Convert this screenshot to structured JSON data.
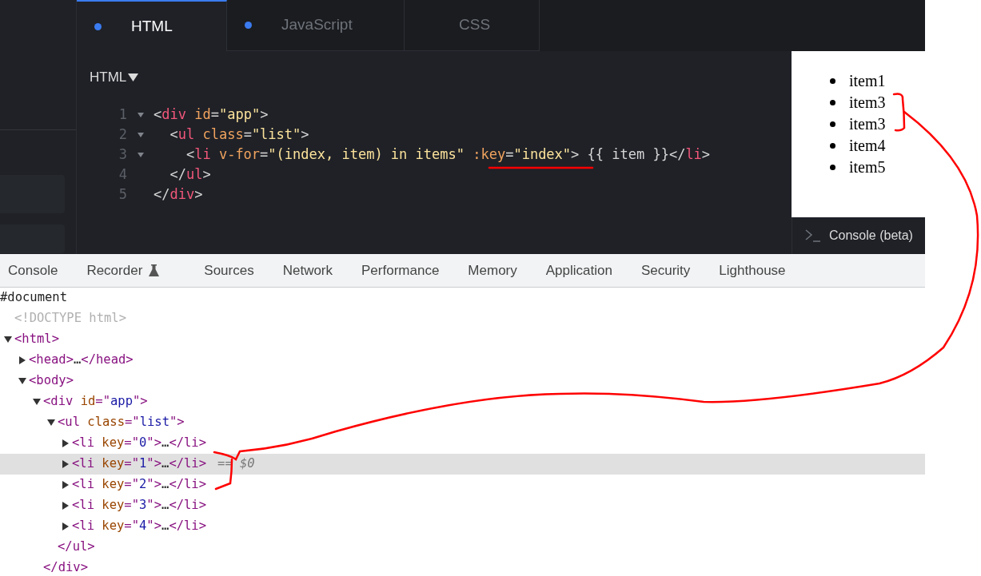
{
  "editor_tabs": [
    {
      "label": "HTML",
      "selected": true,
      "dot": true
    },
    {
      "label": "JavaScript",
      "selected": false,
      "dot": true
    },
    {
      "label": "CSS",
      "selected": false,
      "dot": false
    }
  ],
  "editor": {
    "language": "HTML",
    "lines": [
      {
        "number": "1",
        "foldable": true,
        "tokens": [
          {
            "kind": "punct",
            "text": "<"
          },
          {
            "kind": "tag",
            "text": "div"
          },
          {
            "kind": "attr",
            "text": " id"
          },
          {
            "kind": "punct",
            "text": "="
          },
          {
            "kind": "string",
            "text": "\"app\""
          },
          {
            "kind": "punct",
            "text": ">"
          }
        ]
      },
      {
        "number": "2",
        "foldable": true,
        "tokens": [
          {
            "kind": "punct",
            "text": "  <"
          },
          {
            "kind": "tag",
            "text": "ul"
          },
          {
            "kind": "attr",
            "text": " class"
          },
          {
            "kind": "punct",
            "text": "="
          },
          {
            "kind": "string",
            "text": "\"list\""
          },
          {
            "kind": "punct",
            "text": ">"
          }
        ]
      },
      {
        "number": "3",
        "foldable": true,
        "tokens": [
          {
            "kind": "punct",
            "text": "    <"
          },
          {
            "kind": "tag",
            "text": "li"
          },
          {
            "kind": "attr",
            "text": " v-for"
          },
          {
            "kind": "punct",
            "text": "="
          },
          {
            "kind": "string",
            "text": "\"(index, item) in items\""
          },
          {
            "kind": "attr",
            "text": " :key"
          },
          {
            "kind": "punct",
            "text": "="
          },
          {
            "kind": "string",
            "text": "\"index\""
          },
          {
            "kind": "punct",
            "text": "> {{ item }}</"
          },
          {
            "kind": "tag",
            "text": "li"
          },
          {
            "kind": "punct",
            "text": ">"
          }
        ]
      },
      {
        "number": "4",
        "foldable": false,
        "tokens": [
          {
            "kind": "punct",
            "text": "  </"
          },
          {
            "kind": "tag",
            "text": "ul"
          },
          {
            "kind": "punct",
            "text": ">"
          }
        ]
      },
      {
        "number": "5",
        "foldable": false,
        "tokens": [
          {
            "kind": "punct",
            "text": "</"
          },
          {
            "kind": "tag",
            "text": "div"
          },
          {
            "kind": "punct",
            "text": ">"
          }
        ]
      }
    ]
  },
  "preview": {
    "items": [
      "item1",
      "item3",
      "item3",
      "item4",
      "item5"
    ]
  },
  "console_button": {
    "label": "Console (beta)"
  },
  "devtools_tabs": [
    {
      "label": "Console",
      "kind": "plain"
    },
    {
      "label": "Recorder",
      "kind": "flask"
    },
    {
      "label": "Sources",
      "kind": "plain"
    },
    {
      "label": "Network",
      "kind": "plain"
    },
    {
      "label": "Performance",
      "kind": "plain"
    },
    {
      "label": "Memory",
      "kind": "plain"
    },
    {
      "label": "Application",
      "kind": "plain"
    },
    {
      "label": "Security",
      "kind": "plain"
    },
    {
      "label": "Lighthouse",
      "kind": "plain"
    }
  ],
  "dom_tree": {
    "root": "#document",
    "nodes": [
      {
        "tokens": [
          {
            "kind": "doctype",
            "text": "<!DOCTYPE html>"
          }
        ],
        "selected": false
      },
      {
        "tokens": [
          {
            "kind": "punct",
            "text": "<"
          },
          {
            "kind": "tag",
            "text": "html"
          },
          {
            "kind": "punct",
            "text": ">"
          }
        ],
        "expanded": true,
        "selected": false,
        "children": [
          {
            "tokens": [
              {
                "kind": "punct",
                "text": "<"
              },
              {
                "kind": "tag",
                "text": "head"
              },
              {
                "kind": "punct",
                "text": ">"
              },
              {
                "kind": "text",
                "text": "…"
              },
              {
                "kind": "punct",
                "text": "</"
              },
              {
                "kind": "tag",
                "text": "head"
              },
              {
                "kind": "punct",
                "text": ">"
              }
            ],
            "expanded": false,
            "selected": false
          },
          {
            "tokens": [
              {
                "kind": "punct",
                "text": "<"
              },
              {
                "kind": "tag",
                "text": "body"
              },
              {
                "kind": "punct",
                "text": ">"
              }
            ],
            "expanded": true,
            "selected": false,
            "children": [
              {
                "tokens": [
                  {
                    "kind": "punct",
                    "text": "<"
                  },
                  {
                    "kind": "tag",
                    "text": "div"
                  },
                  {
                    "kind": "attr",
                    "text": " id"
                  },
                  {
                    "kind": "punct",
                    "text": "=\""
                  },
                  {
                    "kind": "value",
                    "text": "app"
                  },
                  {
                    "kind": "punct",
                    "text": "\">"
                  }
                ],
                "expanded": true,
                "selected": false,
                "close": "</div>",
                "children": [
                  {
                    "tokens": [
                      {
                        "kind": "punct",
                        "text": "<"
                      },
                      {
                        "kind": "tag",
                        "text": "ul"
                      },
                      {
                        "kind": "attr",
                        "text": " class"
                      },
                      {
                        "kind": "punct",
                        "text": "=\""
                      },
                      {
                        "kind": "value",
                        "text": "list"
                      },
                      {
                        "kind": "punct",
                        "text": "\">"
                      }
                    ],
                    "expanded": true,
                    "selected": false,
                    "close": "</ul>",
                    "children": [
                      {
                        "tokens": [
                          {
                            "kind": "punct",
                            "text": "<"
                          },
                          {
                            "kind": "tag",
                            "text": "li"
                          },
                          {
                            "kind": "attr",
                            "text": " key"
                          },
                          {
                            "kind": "punct",
                            "text": "=\""
                          },
                          {
                            "kind": "value",
                            "text": "0"
                          },
                          {
                            "kind": "punct",
                            "text": "\">"
                          },
                          {
                            "kind": "text",
                            "text": "…"
                          },
                          {
                            "kind": "punct",
                            "text": "</li>"
                          }
                        ],
                        "expanded": false,
                        "selected": false
                      },
                      {
                        "tokens": [
                          {
                            "kind": "punct",
                            "text": "<"
                          },
                          {
                            "kind": "tag",
                            "text": "li"
                          },
                          {
                            "kind": "attr",
                            "text": " key"
                          },
                          {
                            "kind": "punct",
                            "text": "=\""
                          },
                          {
                            "kind": "value",
                            "text": "1"
                          },
                          {
                            "kind": "punct",
                            "text": "\">"
                          },
                          {
                            "kind": "text",
                            "text": "…"
                          },
                          {
                            "kind": "punct",
                            "text": "</li>"
                          }
                        ],
                        "expanded": false,
                        "selected": true,
                        "suffix": "== $0"
                      },
                      {
                        "tokens": [
                          {
                            "kind": "punct",
                            "text": "<"
                          },
                          {
                            "kind": "tag",
                            "text": "li"
                          },
                          {
                            "kind": "attr",
                            "text": " key"
                          },
                          {
                            "kind": "punct",
                            "text": "=\""
                          },
                          {
                            "kind": "value",
                            "text": "2"
                          },
                          {
                            "kind": "punct",
                            "text": "\">"
                          },
                          {
                            "kind": "text",
                            "text": "…"
                          },
                          {
                            "kind": "punct",
                            "text": "</li>"
                          }
                        ],
                        "expanded": false,
                        "selected": false
                      },
                      {
                        "tokens": [
                          {
                            "kind": "punct",
                            "text": "<"
                          },
                          {
                            "kind": "tag",
                            "text": "li"
                          },
                          {
                            "kind": "attr",
                            "text": " key"
                          },
                          {
                            "kind": "punct",
                            "text": "=\""
                          },
                          {
                            "kind": "value",
                            "text": "3"
                          },
                          {
                            "kind": "punct",
                            "text": "\">"
                          },
                          {
                            "kind": "text",
                            "text": "…"
                          },
                          {
                            "kind": "punct",
                            "text": "</li>"
                          }
                        ],
                        "expanded": false,
                        "selected": false
                      },
                      {
                        "tokens": [
                          {
                            "kind": "punct",
                            "text": "<"
                          },
                          {
                            "kind": "tag",
                            "text": "li"
                          },
                          {
                            "kind": "attr",
                            "text": " key"
                          },
                          {
                            "kind": "punct",
                            "text": "=\""
                          },
                          {
                            "kind": "value",
                            "text": "4"
                          },
                          {
                            "kind": "punct",
                            "text": "\">"
                          },
                          {
                            "kind": "text",
                            "text": "…"
                          },
                          {
                            "kind": "punct",
                            "text": "</li>"
                          }
                        ],
                        "expanded": false,
                        "selected": false
                      }
                    ]
                  }
                ]
              }
            ]
          }
        ]
      }
    ]
  }
}
